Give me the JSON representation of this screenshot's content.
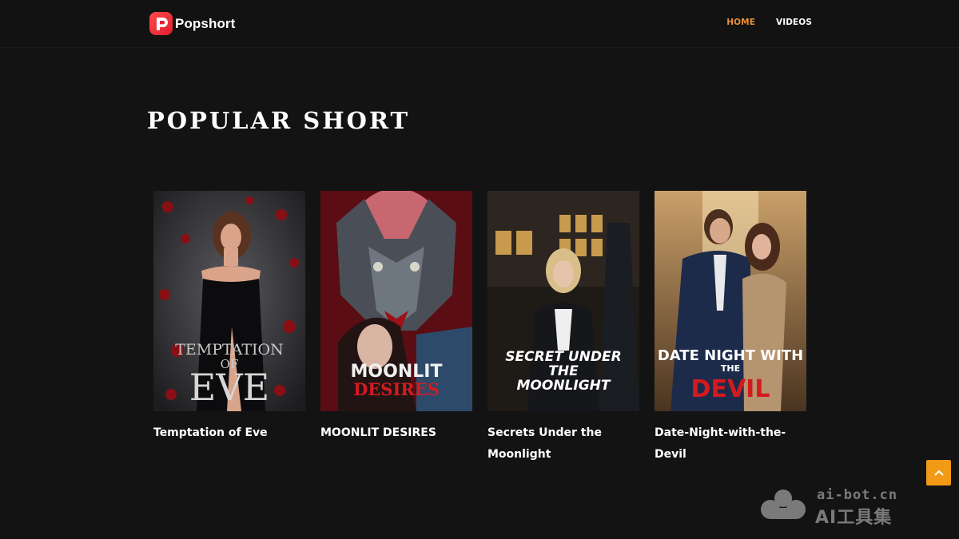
{
  "header": {
    "brand": "Popshort",
    "nav": [
      {
        "label": "HOME",
        "active": true
      },
      {
        "label": "VIDEOS",
        "active": false
      }
    ]
  },
  "section": {
    "title": "POPULAR SHORT"
  },
  "cards": [
    {
      "title": "Temptation of Eve",
      "cover_text": [
        "TEMPTATION",
        "OF",
        "EVE"
      ]
    },
    {
      "title": "MOONLIT DESIRES",
      "cover_text": [
        "MOONLIT",
        "DESIRES"
      ]
    },
    {
      "title": "Secrets Under the Moonlight",
      "cover_text": [
        "SECRET UNDER",
        "THE",
        "MOONLIGHT"
      ]
    },
    {
      "title": "Date-Night-with-the-Devil",
      "cover_text": [
        "DATE NIGHT WITH",
        "THE",
        "DEVIL"
      ]
    }
  ],
  "watermark": {
    "domain": "ai-bot.cn",
    "name": "AI工具集"
  },
  "colors": {
    "background": "#131313",
    "accent_nav": "#e8913a",
    "scroll_button": "#f29a15",
    "brand_red": "#e01f2d"
  },
  "icons": {
    "logo": "popshort-logo-icon",
    "scroll_top": "chevron-up-icon"
  }
}
